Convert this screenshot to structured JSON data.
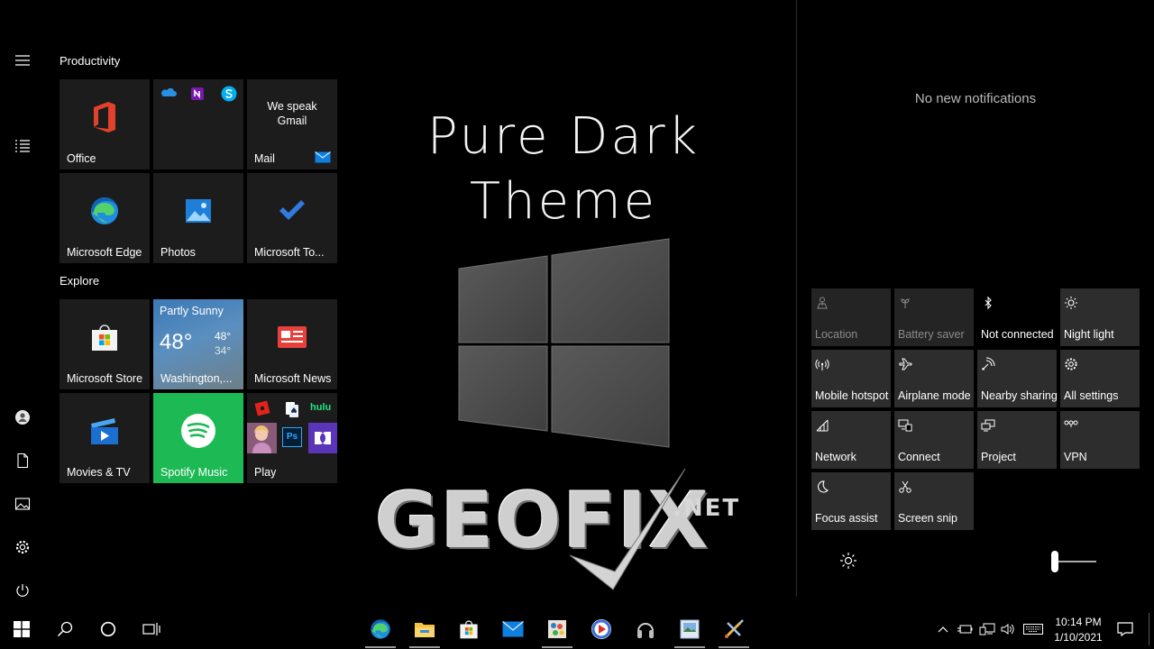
{
  "start": {
    "groups": [
      {
        "title": "Productivity"
      },
      {
        "title": "Explore"
      }
    ],
    "tiles": {
      "office": {
        "label": "Office"
      },
      "mail": {
        "label": "Mail",
        "text": "We speak Gmail"
      },
      "edge": {
        "label": "Microsoft Edge"
      },
      "photos": {
        "label": "Photos"
      },
      "todo": {
        "label": "Microsoft To..."
      },
      "store": {
        "label": "Microsoft Store"
      },
      "weather": {
        "condition": "Partly Sunny",
        "temp": "48°",
        "high": "48°",
        "low": "34°",
        "label": "Washington,..."
      },
      "news": {
        "label": "Microsoft News"
      },
      "movies": {
        "label": "Movies & TV"
      },
      "spotify": {
        "label": "Spotify Music"
      },
      "play": {
        "label": "Play",
        "hulu": "hulu",
        "ps": "Ps"
      }
    }
  },
  "wallpaper": {
    "title_line1": "Pure Dark",
    "title_line2": "Theme",
    "logo_main": "GEOFIX",
    "logo_suffix": ".NET"
  },
  "action_center": {
    "notifications_text": "No new notifications",
    "quick_actions": [
      {
        "label": "Location",
        "icon": "location-icon",
        "state": "disabled"
      },
      {
        "label": "Battery saver",
        "icon": "battery-saver-icon",
        "state": "disabled"
      },
      {
        "label": "Not connected",
        "icon": "bluetooth-icon",
        "state": "off"
      },
      {
        "label": "Night light",
        "icon": "night-light-icon",
        "state": "normal"
      },
      {
        "label": "Mobile hotspot",
        "icon": "hotspot-icon",
        "state": "normal"
      },
      {
        "label": "Airplane mode",
        "icon": "airplane-icon",
        "state": "normal"
      },
      {
        "label": "Nearby sharing",
        "icon": "nearby-sharing-icon",
        "state": "normal"
      },
      {
        "label": "All settings",
        "icon": "settings-icon",
        "state": "normal"
      },
      {
        "label": "Network",
        "icon": "network-icon",
        "state": "normal"
      },
      {
        "label": "Connect",
        "icon": "connect-icon",
        "state": "normal"
      },
      {
        "label": "Project",
        "icon": "project-icon",
        "state": "normal"
      },
      {
        "label": "VPN",
        "icon": "vpn-icon",
        "state": "normal"
      },
      {
        "label": "Focus assist",
        "icon": "focus-assist-icon",
        "state": "normal"
      },
      {
        "label": "Screen snip",
        "icon": "screen-snip-icon",
        "state": "normal"
      }
    ],
    "brightness": 0
  },
  "taskbar": {
    "time": "10:14 PM",
    "date": "1/10/2021"
  },
  "colors": {
    "spotify_green": "#1db954",
    "accent_blue": "#0078d4",
    "tile_bg": "#1c1c1c"
  }
}
